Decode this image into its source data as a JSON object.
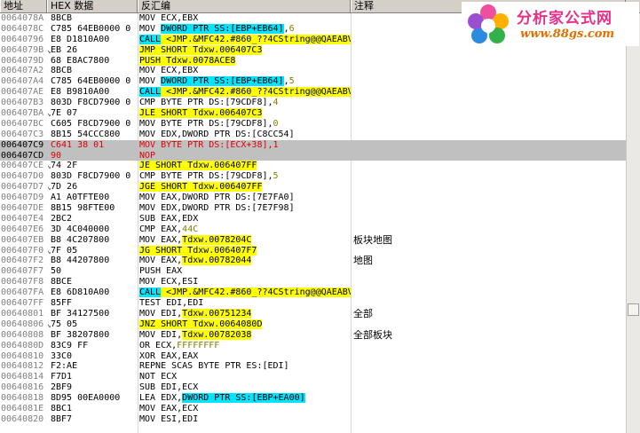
{
  "headers": {
    "address": "地址",
    "hex": "HEX 数据",
    "disasm": "反汇编",
    "comment": "注释"
  },
  "watermark": {
    "title": "分析家公式网",
    "url": "www.88gs.com"
  },
  "rows": [
    {
      "addr": "0064078A",
      "mark": "",
      "hex": "8BCB",
      "dis": [
        {
          "t": "MOV ECX,EBX"
        }
      ],
      "cmt": ""
    },
    {
      "addr": "0064078C",
      "mark": "",
      "hex": "C785 64EB0000 0",
      "dis": [
        {
          "t": "MOV "
        },
        {
          "t": "DWORD PTR SS:[EBP+EB64]",
          "c": "hl-c"
        },
        {
          "t": ","
        },
        {
          "t": "6",
          "c": "imm"
        }
      ],
      "cmt": ""
    },
    {
      "addr": "00640796",
      "mark": "",
      "hex": "E8 D1810A00",
      "dis": [
        {
          "t": "CALL",
          "c": "hl-c"
        },
        {
          "t": " <JMP.&MFC42.#860_??4CString@@QAEABV",
          "c": "hl-y"
        }
      ],
      "cmt": ""
    },
    {
      "addr": "0064079B",
      "mark": "⌄",
      "hex": "EB 26",
      "dis": [
        {
          "t": "JMP SHORT Tdxw.006407C3",
          "c": "hl-y"
        }
      ],
      "cmt": ""
    },
    {
      "addr": "0064079D",
      "mark": "",
      "hex": "68 E8AC7800",
      "dis": [
        {
          "t": "PUSH Tdxw.0078ACE8",
          "c": "hl-y"
        }
      ],
      "cmt": ""
    },
    {
      "addr": "006407A2",
      "mark": "",
      "hex": "8BCB",
      "dis": [
        {
          "t": "MOV ECX,EBX"
        }
      ],
      "cmt": ""
    },
    {
      "addr": "006407A4",
      "mark": "",
      "hex": "C785 64EB0000 0",
      "dis": [
        {
          "t": "MOV "
        },
        {
          "t": "DWORD PTR SS:[EBP+EB64]",
          "c": "hl-c"
        },
        {
          "t": ","
        },
        {
          "t": "5",
          "c": "imm"
        }
      ],
      "cmt": ""
    },
    {
      "addr": "006407AE",
      "mark": "",
      "hex": "E8 B9810A00",
      "dis": [
        {
          "t": "CALL",
          "c": "hl-c"
        },
        {
          "t": " <JMP.&MFC42.#860_??4CString@@QAEABV",
          "c": "hl-y"
        }
      ],
      "cmt": ""
    },
    {
      "addr": "006407B3",
      "mark": "",
      "hex": "803D F8CD7900 0",
      "dis": [
        {
          "t": "CMP BYTE PTR DS:[79CDF8],"
        },
        {
          "t": "4",
          "c": "imm"
        }
      ],
      "cmt": ""
    },
    {
      "addr": "006407BA",
      "mark": "⌄",
      "hex": "7E 07",
      "dis": [
        {
          "t": "JLE SHORT Tdxw.006407C3",
          "c": "hl-y"
        }
      ],
      "cmt": ""
    },
    {
      "addr": "006407BC",
      "mark": "",
      "hex": "C605 F8CD7900 0",
      "dis": [
        {
          "t": "MOV BYTE PTR DS:[79CDF8],"
        },
        {
          "t": "0",
          "c": "imm"
        }
      ],
      "cmt": ""
    },
    {
      "addr": "006407C3",
      "mark": "",
      "hex": "8B15 54CCC800",
      "dis": [
        {
          "t": "MOV EDX,DWORD PTR DS:[C8CC54]"
        }
      ],
      "cmt": ""
    },
    {
      "addr": "006407C9",
      "mark": "",
      "hex": "C641 38 01",
      "dis": [
        {
          "t": "MOV BYTE PTR DS:[ECX+38],1"
        }
      ],
      "cmt": "",
      "sel": true
    },
    {
      "addr": "006407CD",
      "mark": "",
      "hex": "90",
      "dis": [
        {
          "t": "NOP"
        }
      ],
      "cmt": "",
      "sel": true
    },
    {
      "addr": "006407CE",
      "mark": "⌄",
      "hex": "74 2F",
      "dis": [
        {
          "t": "JE SHORT Tdxw.006407FF",
          "c": "hl-y"
        }
      ],
      "cmt": ""
    },
    {
      "addr": "006407D0",
      "mark": "",
      "hex": "803D F8CD7900 0",
      "dis": [
        {
          "t": "CMP BYTE PTR DS:[79CDF8],"
        },
        {
          "t": "5",
          "c": "imm"
        }
      ],
      "cmt": ""
    },
    {
      "addr": "006407D7",
      "mark": "⌄",
      "hex": "7D 26",
      "dis": [
        {
          "t": "JGE SHORT Tdxw.006407FF",
          "c": "hl-y"
        }
      ],
      "cmt": ""
    },
    {
      "addr": "006407D9",
      "mark": "",
      "hex": "A1 A0TFTE00",
      "dis": [
        {
          "t": "MOV EAX,DWORD PTR DS:[7E7FA0]"
        }
      ],
      "cmt": ""
    },
    {
      "addr": "006407DE",
      "mark": "",
      "hex": "8B15 98FTE00",
      "dis": [
        {
          "t": "MOV EDX,DWORD PTR DS:[7E7F98]"
        }
      ],
      "cmt": ""
    },
    {
      "addr": "006407E4",
      "mark": "",
      "hex": "2BC2",
      "dis": [
        {
          "t": "SUB EAX,EDX"
        }
      ],
      "cmt": ""
    },
    {
      "addr": "006407E6",
      "mark": "",
      "hex": "3D 4C040000",
      "dis": [
        {
          "t": "CMP EAX,"
        },
        {
          "t": "44C",
          "c": "imm"
        }
      ],
      "cmt": ""
    },
    {
      "addr": "006407EB",
      "mark": "",
      "hex": "B8 4C207800",
      "dis": [
        {
          "t": "MOV EAX,"
        },
        {
          "t": "Tdxw.0078204C",
          "c": "hl-y"
        }
      ],
      "cmt": "板块地图"
    },
    {
      "addr": "006407F0",
      "mark": "⌄",
      "hex": "7F 05",
      "dis": [
        {
          "t": "JG SHORT Tdxw.006407F7",
          "c": "hl-y"
        }
      ],
      "cmt": ""
    },
    {
      "addr": "006407F2",
      "mark": "",
      "hex": "B8 44207800",
      "dis": [
        {
          "t": "MOV EAX,"
        },
        {
          "t": "Tdxw.00782044",
          "c": "hl-y"
        }
      ],
      "cmt": "地图"
    },
    {
      "addr": "006407F7",
      "mark": "",
      "hex": "50",
      "dis": [
        {
          "t": "PUSH EAX"
        }
      ],
      "cmt": ""
    },
    {
      "addr": "006407F8",
      "mark": "",
      "hex": "8BCE",
      "dis": [
        {
          "t": "MOV ECX,ESI"
        }
      ],
      "cmt": ""
    },
    {
      "addr": "006407FA",
      "mark": "",
      "hex": "E8 6D810A00",
      "dis": [
        {
          "t": "CALL",
          "c": "hl-c"
        },
        {
          "t": " <JMP.&MFC42.#860_??4CString@@QAEABV",
          "c": "hl-y"
        }
      ],
      "cmt": ""
    },
    {
      "addr": "006407FF",
      "mark": "",
      "hex": "85FF",
      "dis": [
        {
          "t": "TEST EDI,EDI"
        }
      ],
      "cmt": ""
    },
    {
      "addr": "00640801",
      "mark": "",
      "hex": "BF 34127500",
      "dis": [
        {
          "t": "MOV EDI,"
        },
        {
          "t": "Tdxw.00751234",
          "c": "hl-y"
        }
      ],
      "cmt": "全部"
    },
    {
      "addr": "00640806",
      "mark": "⌄",
      "hex": "75 05",
      "dis": [
        {
          "t": "JNZ SHORT Tdxw.0064080D",
          "c": "hl-y"
        }
      ],
      "cmt": ""
    },
    {
      "addr": "00640808",
      "mark": "",
      "hex": "BF 38207800",
      "dis": [
        {
          "t": "MOV EDI,"
        },
        {
          "t": "Tdxw.00782038",
          "c": "hl-y"
        }
      ],
      "cmt": "全部板块"
    },
    {
      "addr": "0064080D",
      "mark": "",
      "hex": "83C9 FF",
      "dis": [
        {
          "t": "OR ECX,"
        },
        {
          "t": "FFFFFFFF",
          "c": "imm"
        }
      ],
      "cmt": ""
    },
    {
      "addr": "00640810",
      "mark": "",
      "hex": "33C0",
      "dis": [
        {
          "t": "XOR EAX,EAX"
        }
      ],
      "cmt": ""
    },
    {
      "addr": "00640812",
      "mark": "",
      "hex": "F2:AE",
      "dis": [
        {
          "t": "REPNE SCAS BYTE PTR ES:[EDI]"
        }
      ],
      "cmt": ""
    },
    {
      "addr": "00640814",
      "mark": "",
      "hex": "F7D1",
      "dis": [
        {
          "t": "NOT ECX"
        }
      ],
      "cmt": ""
    },
    {
      "addr": "00640816",
      "mark": "",
      "hex": "2BF9",
      "dis": [
        {
          "t": "SUB EDI,ECX"
        }
      ],
      "cmt": ""
    },
    {
      "addr": "00640818",
      "mark": "",
      "hex": "8D95 00EA0000",
      "dis": [
        {
          "t": "LEA EDX,"
        },
        {
          "t": "DWORD PTR SS:[EBP+EA00]",
          "c": "hl-c"
        }
      ],
      "cmt": ""
    },
    {
      "addr": "0064081E",
      "mark": "",
      "hex": "8BC1",
      "dis": [
        {
          "t": "MOV EAX,ECX"
        }
      ],
      "cmt": ""
    },
    {
      "addr": "00640820",
      "mark": "",
      "hex": "8BF7",
      "dis": [
        {
          "t": "MOV ESI,EDI"
        }
      ],
      "cmt": ""
    }
  ]
}
